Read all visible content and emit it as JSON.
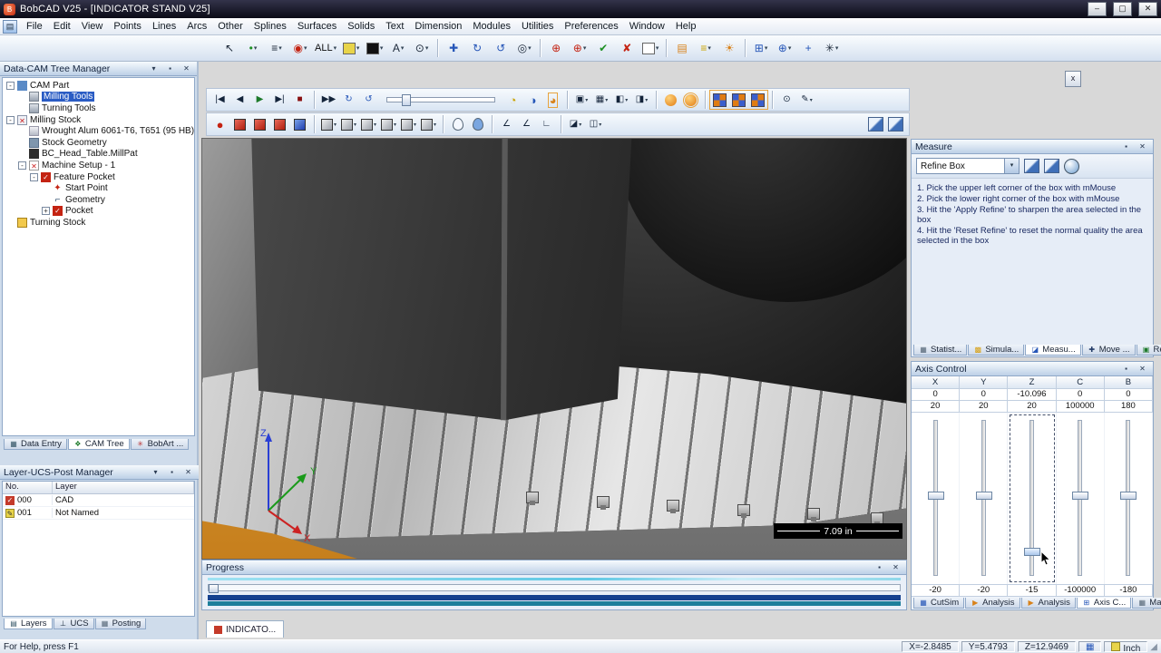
{
  "colors": {
    "selection_blue": "#2a5cc4",
    "axis_x_red": "#cc2222",
    "axis_y_green": "#1a9a1a",
    "axis_z_blue": "#2a3fd4",
    "fixture_orange": "#dd9a33",
    "progress_blue": "#15418f",
    "progress_teal": "#1d7f9b",
    "progress_cyan": "#63cbe6"
  },
  "icons": {
    "dd": "▾",
    "pin": "▪",
    "close": "✕",
    "min": "–",
    "max": "▢",
    "app": "B",
    "menu-doc": "▤",
    "cursor": "↖",
    "point": "•",
    "filter": "≡",
    "mask": "◉",
    "text": "A",
    "zoom": "⊙",
    "pan": "✚",
    "rotate": "↻",
    "orbit": "↺",
    "fit": "◎",
    "origin": "⊕",
    "check": "✔",
    "cross": "✘",
    "comb": "▤",
    "stripes": "≡",
    "sun": "☀",
    "gridsnap": "⊞",
    "osnap": "⊕",
    "target": "+",
    "star": "✳",
    "tostart": "|◀",
    "stepback": "◀",
    "play": "▶",
    "toend": "▶|",
    "stop": "■",
    "ffwd": "▶▶",
    "loop": "↻",
    "loop2": "↺",
    "clock1": "◔",
    "clock2": "◑",
    "clock3": "◕",
    "report-sq": "▣",
    "film": "▦",
    "half": "◧",
    "half2": "◨",
    "pencil": "✎",
    "dot": "●",
    "angle": "∠",
    "angle2": "∟",
    "section": "◪",
    "section2": "◫",
    "expand": "-",
    "folder": " ",
    "tcheck": "✓",
    "tx": "✕",
    "tstar": "✦",
    "tgeom": "⌐",
    "tpen": "✎",
    "perp": "⊥",
    "tree": "❖",
    "grid9": "▩",
    "sq": "▦"
  },
  "title_bar": {
    "title": "BobCAD V25 - [INDICATOR STAND V25]"
  },
  "menu_bar": {
    "items": [
      "File",
      "Edit",
      "View",
      "Points",
      "Lines",
      "Arcs",
      "Other",
      "Splines",
      "Surfaces",
      "Solids",
      "Text",
      "Dimension",
      "Modules",
      "Utilities",
      "Preferences",
      "Window",
      "Help"
    ]
  },
  "main_toolbar": {
    "all_label": "ALL"
  },
  "cam_panel": {
    "title": "Data-CAM Tree Manager",
    "items": [
      {
        "label": "CAM Part",
        "expander": "-"
      },
      {
        "label": "Milling Tools",
        "expander": ""
      },
      {
        "label": "Turning Tools",
        "expander": ""
      },
      {
        "label": "Milling Stock",
        "expander": "-"
      },
      {
        "label": "Wrought Alum 6061-T6, T651 (95 HB)",
        "expander": ""
      },
      {
        "label": "Stock Geometry",
        "expander": ""
      },
      {
        "label": "BC_Head_Table.MillPat",
        "expander": ""
      },
      {
        "label": "Machine Setup - 1",
        "expander": "-"
      },
      {
        "label": "Feature Pocket",
        "expander": "-"
      },
      {
        "label": "Start Point",
        "expander": ""
      },
      {
        "label": "Geometry",
        "expander": ""
      },
      {
        "label": "Pocket",
        "expander": "+"
      },
      {
        "label": "Turning Stock",
        "expander": ""
      }
    ],
    "tabs": [
      "Data Entry",
      "CAM Tree",
      "BobArt ..."
    ]
  },
  "layer_panel": {
    "title": "Layer-UCS-Post Manager",
    "col_no": "No.",
    "col_layer": "Layer",
    "rows": [
      {
        "no": "000",
        "layer": "CAD"
      },
      {
        "no": "001",
        "layer": "Not Named"
      }
    ],
    "tabs": [
      "Layers",
      "UCS",
      "Posting"
    ]
  },
  "viewport": {
    "scale_label": "7.09 in",
    "axis_x": "X",
    "axis_y": "Y",
    "axis_z": "Z",
    "close_label": "x"
  },
  "measure_panel": {
    "title": "Measure",
    "dropdown_value": "Refine Box",
    "instructions": [
      "1. Pick the upper left corner of the box with mMouse",
      "2. Pick the lower right corner of the box with mMouse",
      "3. Hit the 'Apply Refine' to sharpen the area selected in the box",
      "4. Hit the 'Reset Refine' to reset the normal quality the area selected in the box"
    ],
    "tabs": [
      "Statist...",
      "Simula...",
      "Measu...",
      "Move ...",
      "Report"
    ]
  },
  "axis_panel": {
    "title": "Axis Control",
    "axes": [
      {
        "name": "X",
        "value": "0",
        "max": "20",
        "min": "-20"
      },
      {
        "name": "Y",
        "value": "0",
        "max": "20",
        "min": "-20"
      },
      {
        "name": "Z",
        "value": "-10.096",
        "max": "20",
        "min": "-15"
      },
      {
        "name": "C",
        "value": "0",
        "max": "100000",
        "min": "-100000"
      },
      {
        "name": "B",
        "value": "0",
        "max": "180",
        "min": "-180"
      }
    ],
    "tabs": [
      "CutSim",
      "Analysis",
      "Analysis",
      "Axis C...",
      "Machi..."
    ]
  },
  "progress_panel": {
    "title": "Progress"
  },
  "document_tab": {
    "label": "INDICATO..."
  },
  "status_bar": {
    "help": "For Help, press F1",
    "x": "X=-2.8485",
    "y": "Y=5.4793",
    "z": "Z=12.9469",
    "units": "Inch"
  }
}
